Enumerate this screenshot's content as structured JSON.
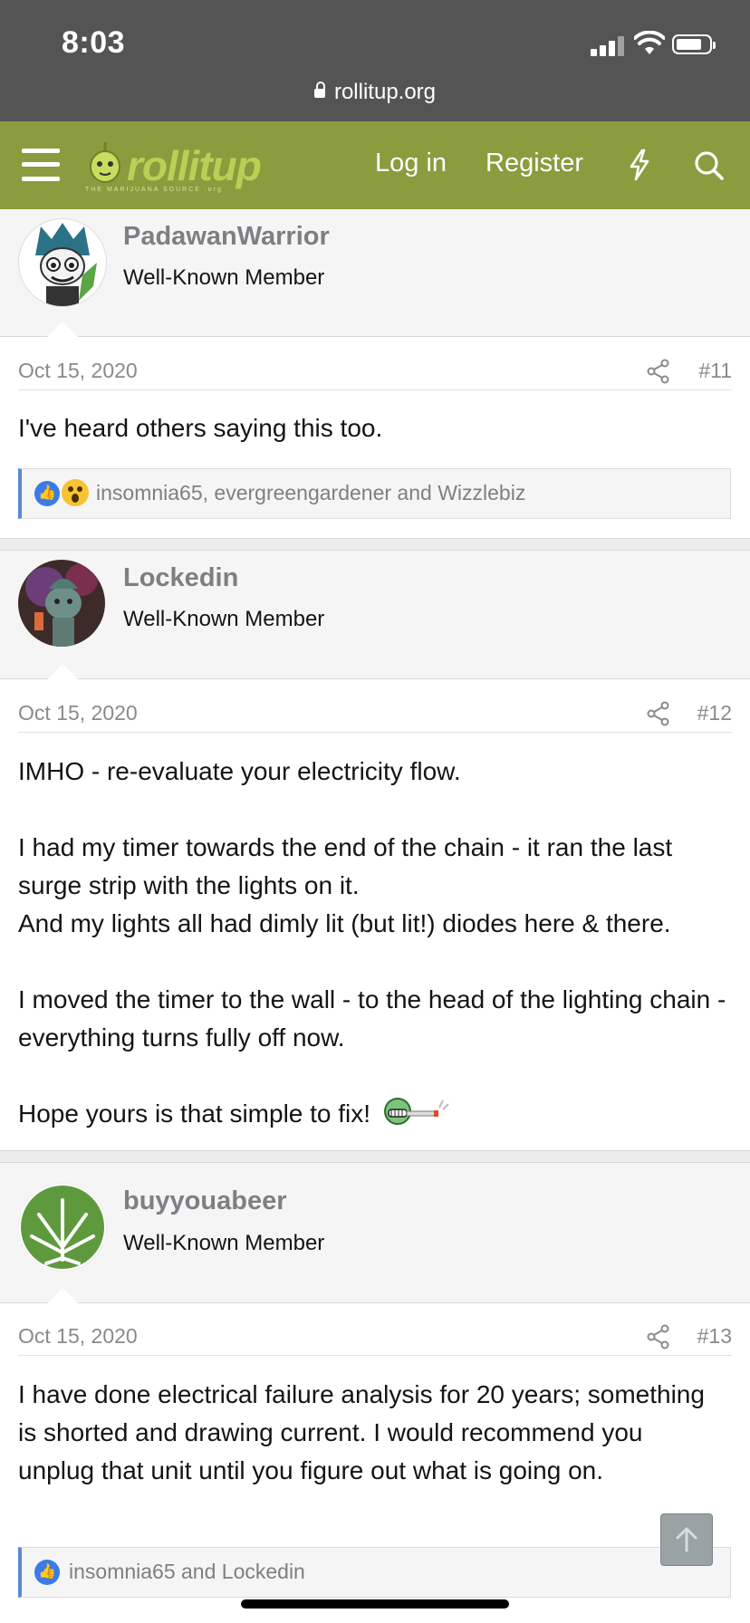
{
  "status_bar": {
    "time": "8:03",
    "url": "rollitup.org"
  },
  "nav": {
    "logo_text": "rollitup",
    "logo_tagline": "THE MARIJUANA SOURCE .org",
    "login_label": "Log in",
    "register_label": "Register",
    "accent_color": "#8a9c3e"
  },
  "posts": [
    {
      "username": "PadawanWarrior",
      "user_title": "Well-Known Member",
      "date": "Oct 15, 2020",
      "post_number": "#11",
      "body": [
        "I've heard others saying this too."
      ],
      "reactions": "insomnia65, evergreengardener and Wizzlebiz"
    },
    {
      "username": "Lockedin",
      "user_title": "Well-Known Member",
      "date": "Oct 15, 2020",
      "post_number": "#12",
      "body": [
        "IMHO - re-evaluate your electricity flow.",
        "I had my timer towards the end of the chain - it ran the last surge strip with the lights on it.",
        "And my lights all had dimly lit (but lit!) diodes here & there.",
        "I moved the timer to the wall - to the head of the lighting chain - everything turns fully off now.",
        "Hope yours is that simple to fix!"
      ]
    },
    {
      "username": "buyyouabeer",
      "user_title": "Well-Known Member",
      "date": "Oct 15, 2020",
      "post_number": "#13",
      "body": [
        "I have done electrical failure analysis for 20 years; something is shorted and drawing current. I would recommend you unplug that unit until you figure out what is going on."
      ],
      "reactions": "insomnia65 and Lockedin"
    }
  ]
}
